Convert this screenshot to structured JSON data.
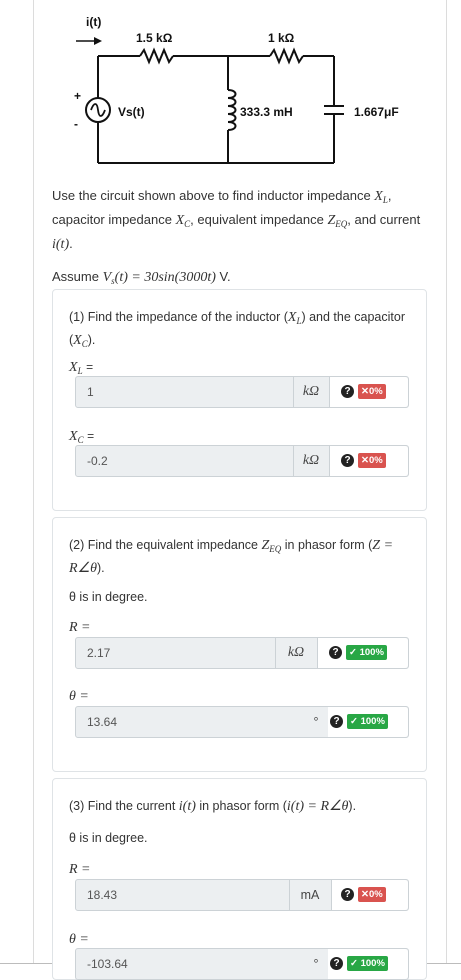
{
  "circuit": {
    "current_label": "i(t)",
    "r1": "1.5 kΩ",
    "r2": "1 kΩ",
    "source": "Vs(t)",
    "inductor": "333.3 mH",
    "capacitor": "1.667μF",
    "plus": "+",
    "minus": "-"
  },
  "intro": {
    "p1_a": "Use the circuit shown above to find inductor impedance ",
    "p1_b": ", capacitor impedance ",
    "p1_c": ", equivalent impedance ",
    "p1_d": ", and current ",
    "p1_e": ".",
    "p2_a": "Assume ",
    "p2_math": "Vs(t) = 30sin(3000t)",
    "p2_b": " V."
  },
  "part1": {
    "q_a": "(1) Find the impedance of the inductor (",
    "q_b": ") and the capacitor (",
    "q_c": ").",
    "xl": {
      "label": "XL =",
      "value": "1",
      "unit": "kΩ",
      "status": "bad",
      "score": "0%"
    },
    "xc": {
      "label": "XC =",
      "value": "-0.2",
      "unit": "kΩ",
      "status": "bad",
      "score": "0%"
    }
  },
  "part2": {
    "q_a": "(2) Find the equivalent impedance ",
    "q_b": " in phasor form (",
    "q_math": "Z = R∠θ",
    "q_c": ").",
    "note": "θ is in degree.",
    "r": {
      "label": "R =",
      "value": "2.17",
      "unit": "kΩ",
      "status": "good",
      "score": "100%"
    },
    "theta": {
      "label": "θ =",
      "value": "13.64",
      "unit": "°",
      "status": "good",
      "score": "100%"
    }
  },
  "part3": {
    "q_a": "(3) Find the current ",
    "q_b": " in phasor form (",
    "q_math": "i(t) = R∠θ",
    "q_c": ").",
    "note": "θ is in degree.",
    "r": {
      "label": "R =",
      "value": "18.43",
      "unit": "mA",
      "status": "bad",
      "score": "0%"
    },
    "theta": {
      "label": "θ =",
      "value": "-103.64",
      "unit": "°",
      "status": "good",
      "score": "100%"
    }
  },
  "symbols": {
    "xl": "XL",
    "xc": "XC",
    "zeq": "ZEQ",
    "it": "i(t)",
    "x_mark": "✕",
    "check_mark": "✓",
    "question": "?"
  },
  "colors": {
    "bad": "#d9534f",
    "good": "#28a745"
  }
}
